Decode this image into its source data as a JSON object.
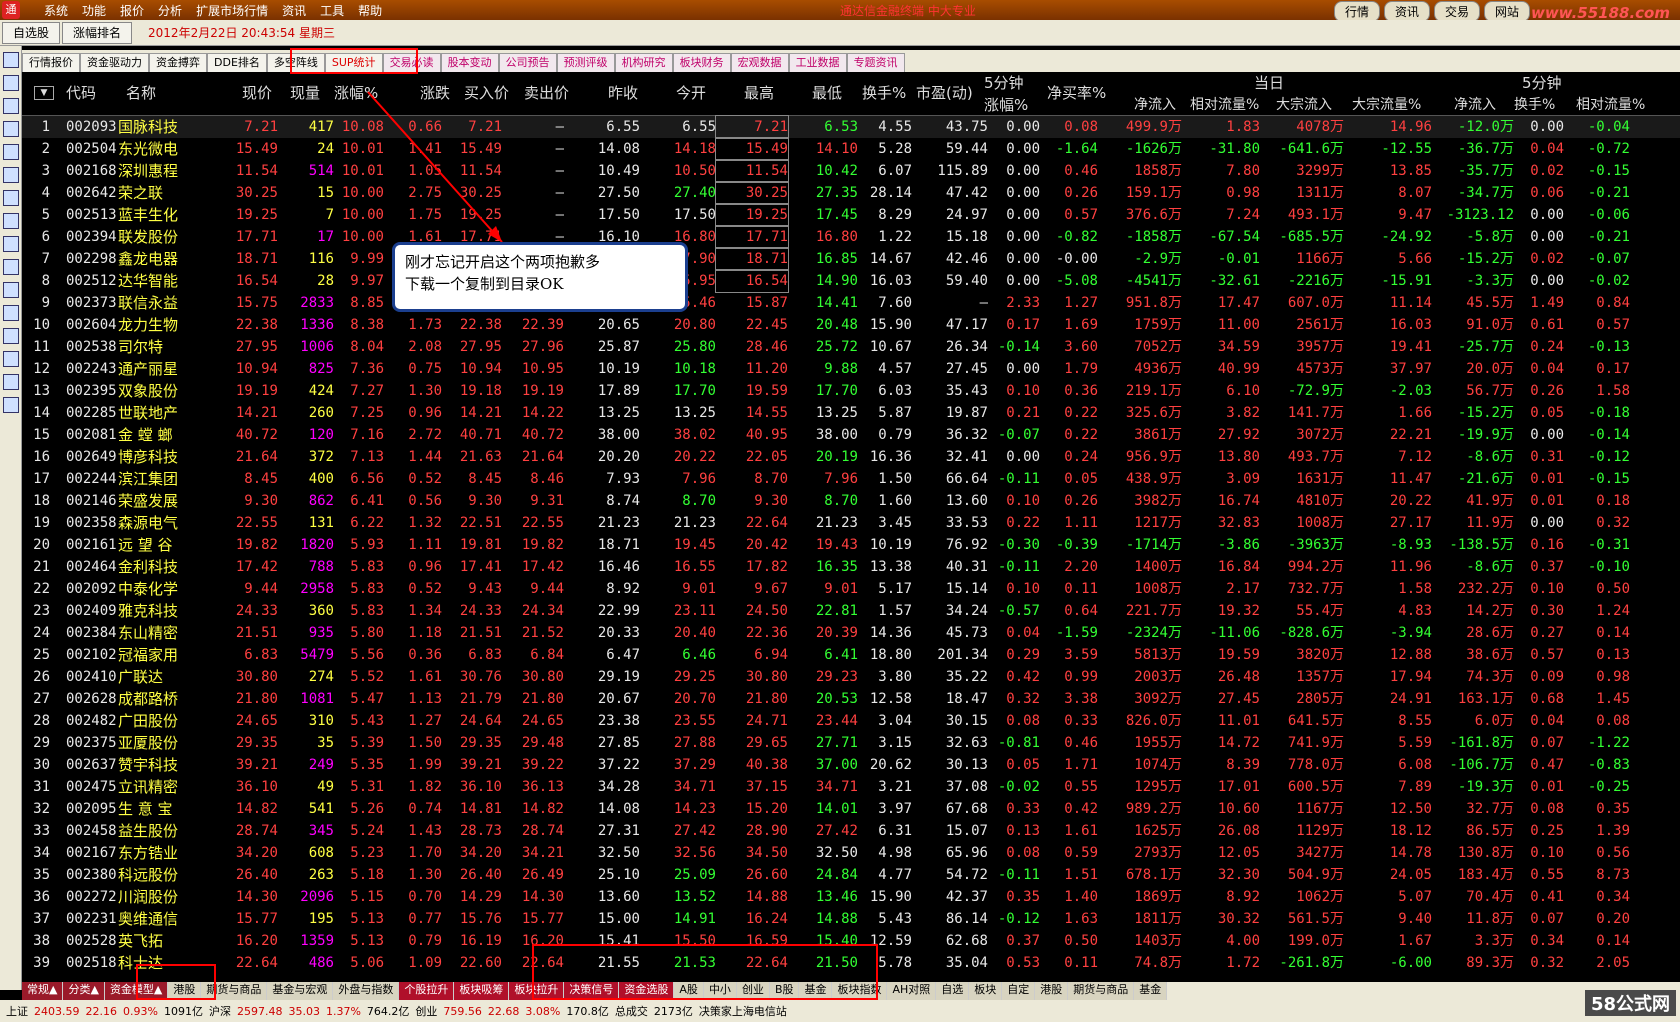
{
  "titlebar": {
    "menu": [
      "系统",
      "功能",
      "报价",
      "分析",
      "扩展市场行情",
      "资讯",
      "工具",
      "帮助"
    ],
    "title": "通达信金融终端 中大专业",
    "right_tabs": [
      "行情",
      "资讯",
      "交易",
      "网站"
    ],
    "site": "www.55188.com"
  },
  "toolbar": {
    "buttons": [
      "自选股",
      "涨幅排名"
    ],
    "datetime": "2012年2月22日 20:43:54 星期三"
  },
  "top_tabs": [
    "行情报价",
    "资金驱动力",
    "资金搏弈",
    "DDE排名",
    "多空阵线",
    "SUP统计",
    "交易必读",
    "股本变动",
    "公司预告",
    "预测评级",
    "机构研究",
    "板块财务",
    "宏观数据",
    "工业数据",
    "专题资讯"
  ],
  "header": {
    "cols": [
      "代码",
      "名称",
      "现价",
      "现量",
      "涨幅%",
      "涨跌",
      "买入价",
      "卖出价",
      "昨收",
      "今开",
      "最高",
      "最低",
      "换手%",
      "市盈(动)"
    ],
    "min5": "5分钟",
    "min5_rise": "涨幅%",
    "net_buy": "净买率%",
    "today": "当日",
    "today_cols": [
      "净流入",
      "相对流量%",
      "大宗流入",
      "大宗流量%"
    ],
    "min5b": "5分钟",
    "min5b_cols": [
      "净流入",
      "换手%",
      "相对流量%"
    ]
  },
  "rows": [
    [
      "1",
      "002093",
      "国脉科技",
      "7.21",
      "417",
      "10.08",
      "0.66",
      "7.21",
      "—",
      "6.55",
      "6.55",
      "7.21",
      "6.53",
      "4.55",
      "43.75",
      "0.00",
      "0.08",
      "499.9万",
      "1.83",
      "4078万",
      "14.96",
      "-12.0万",
      "0.00",
      "-0.04"
    ],
    [
      "2",
      "002504",
      "东光微电",
      "15.49",
      "24",
      "10.01",
      "1.41",
      "15.49",
      "—",
      "14.08",
      "14.18",
      "15.49",
      "14.10",
      "5.28",
      "59.44",
      "0.00",
      "-1.64",
      "-1626万",
      "-31.80",
      "-641.6万",
      "-12.55",
      "-36.7万",
      "0.04",
      "-0.72"
    ],
    [
      "3",
      "002168",
      "深圳惠程",
      "11.54",
      "514",
      "10.01",
      "1.05",
      "11.54",
      "—",
      "10.49",
      "10.50",
      "11.54",
      "10.42",
      "6.07",
      "115.89",
      "0.00",
      "0.46",
      "1858万",
      "7.80",
      "3299万",
      "13.85",
      "-35.7万",
      "0.02",
      "-0.15"
    ],
    [
      "4",
      "002642",
      "荣之联",
      "30.25",
      "15",
      "10.00",
      "2.75",
      "30.25",
      "—",
      "27.50",
      "27.40",
      "30.25",
      "27.35",
      "28.14",
      "47.42",
      "0.00",
      "0.26",
      "159.1万",
      "0.98",
      "1311万",
      "8.07",
      "-34.7万",
      "0.06",
      "-0.21"
    ],
    [
      "5",
      "002513",
      "蓝丰生化",
      "19.25",
      "7",
      "10.00",
      "1.75",
      "19.25",
      "—",
      "17.50",
      "17.50",
      "19.25",
      "17.45",
      "8.29",
      "24.97",
      "0.00",
      "0.57",
      "376.6万",
      "7.24",
      "493.1万",
      "9.47",
      "-3123.12",
      "0.00",
      "-0.06"
    ],
    [
      "6",
      "002394",
      "联发股份",
      "17.71",
      "17",
      "10.00",
      "1.61",
      "17.71",
      "—",
      "16.10",
      "16.80",
      "17.71",
      "16.80",
      "1.22",
      "15.18",
      "0.00",
      "-0.82",
      "-1858万",
      "-67.54",
      "-685.5万",
      "-24.92",
      "-5.8万",
      "0.00",
      "-0.21"
    ],
    [
      "7",
      "002298",
      "鑫龙电器",
      "18.71",
      "116",
      "9.99",
      "1.70",
      "18.71",
      "—",
      "17.01",
      "17.90",
      "18.71",
      "16.85",
      "14.67",
      "42.46",
      "0.00",
      "-0.00",
      "-2.9万",
      "-0.01",
      "1166万",
      "5.66",
      "-15.2万",
      "0.02",
      "-0.07"
    ],
    [
      "8",
      "002512",
      "达华智能",
      "16.54",
      "28",
      "9.97",
      "1.50",
      "16.54",
      "—",
      "15.04",
      "15.95",
      "16.54",
      "14.90",
      "16.03",
      "59.40",
      "0.00",
      "-5.08",
      "-4541万",
      "-32.61",
      "-2216万",
      "-15.91",
      "-3.3万",
      "0.00",
      "-0.02"
    ],
    [
      "9",
      "002373",
      "联信永益",
      "15.75",
      "2833",
      "8.85",
      "1.28",
      "15.74",
      "15.75",
      "14.47",
      "15.46",
      "15.87",
      "14.41",
      "7.60",
      "—",
      "2.33",
      "1.27",
      "951.8万",
      "17.47",
      "607.0万",
      "11.14",
      "45.5万",
      "1.49",
      "0.84"
    ],
    [
      "10",
      "002604",
      "龙力生物",
      "22.38",
      "1336",
      "8.38",
      "1.73",
      "22.38",
      "22.39",
      "20.65",
      "20.80",
      "22.45",
      "20.48",
      "15.90",
      "47.17",
      "0.17",
      "1.69",
      "1759万",
      "11.00",
      "2561万",
      "16.03",
      "91.0万",
      "0.61",
      "0.57"
    ],
    [
      "11",
      "002538",
      "司尔特",
      "27.95",
      "1006",
      "8.04",
      "2.08",
      "27.95",
      "27.96",
      "25.87",
      "25.80",
      "28.46",
      "25.72",
      "10.67",
      "26.34",
      "-0.14",
      "3.60",
      "7052万",
      "34.59",
      "3957万",
      "19.41",
      "-25.7万",
      "0.24",
      "-0.13"
    ],
    [
      "12",
      "002243",
      "通产丽星",
      "10.94",
      "825",
      "7.36",
      "0.75",
      "10.94",
      "10.95",
      "10.19",
      "10.18",
      "11.20",
      "9.88",
      "4.57",
      "27.45",
      "0.00",
      "1.79",
      "4936万",
      "40.99",
      "4573万",
      "37.97",
      "20.0万",
      "0.04",
      "0.17"
    ],
    [
      "13",
      "002395",
      "双象股份",
      "19.19",
      "424",
      "7.27",
      "1.30",
      "19.18",
      "19.19",
      "17.89",
      "17.70",
      "19.59",
      "17.70",
      "6.03",
      "35.43",
      "0.10",
      "0.36",
      "219.1万",
      "6.10",
      "-72.9万",
      "-2.03",
      "56.7万",
      "0.26",
      "1.58"
    ],
    [
      "14",
      "002285",
      "世联地产",
      "14.21",
      "260",
      "7.25",
      "0.96",
      "14.21",
      "14.22",
      "13.25",
      "13.25",
      "14.55",
      "13.25",
      "5.87",
      "19.87",
      "0.21",
      "0.22",
      "325.6万",
      "3.82",
      "141.7万",
      "1.66",
      "-15.2万",
      "0.05",
      "-0.18"
    ],
    [
      "15",
      "002081",
      "金 螳 螂",
      "40.72",
      "120",
      "7.16",
      "2.72",
      "40.71",
      "40.72",
      "38.00",
      "38.02",
      "40.95",
      "38.00",
      "0.79",
      "36.32",
      "-0.07",
      "0.22",
      "3861万",
      "27.92",
      "3072万",
      "22.21",
      "-19.9万",
      "0.00",
      "-0.14"
    ],
    [
      "16",
      "002649",
      "博彦科技",
      "21.64",
      "372",
      "7.13",
      "1.44",
      "21.63",
      "21.64",
      "20.20",
      "20.22",
      "22.05",
      "20.19",
      "16.36",
      "32.41",
      "0.00",
      "0.24",
      "956.9万",
      "13.80",
      "493.7万",
      "7.12",
      "-8.6万",
      "0.31",
      "-0.12"
    ],
    [
      "17",
      "002244",
      "滨江集团",
      "8.45",
      "400",
      "6.56",
      "0.52",
      "8.45",
      "8.46",
      "7.93",
      "7.96",
      "8.70",
      "7.96",
      "1.50",
      "66.64",
      "-0.11",
      "0.05",
      "438.9万",
      "3.09",
      "1631万",
      "11.47",
      "-21.6万",
      "0.01",
      "-0.15"
    ],
    [
      "18",
      "002146",
      "荣盛发展",
      "9.30",
      "862",
      "6.41",
      "0.56",
      "9.30",
      "9.31",
      "8.74",
      "8.70",
      "9.30",
      "8.70",
      "1.60",
      "13.60",
      "0.10",
      "0.26",
      "3982万",
      "16.74",
      "4810万",
      "20.22",
      "41.9万",
      "0.01",
      "0.18"
    ],
    [
      "19",
      "002358",
      "森源电气",
      "22.55",
      "131",
      "6.22",
      "1.32",
      "22.51",
      "22.55",
      "21.23",
      "21.23",
      "22.64",
      "21.23",
      "3.45",
      "33.53",
      "0.22",
      "1.11",
      "1217万",
      "32.83",
      "1008万",
      "27.17",
      "11.9万",
      "0.00",
      "0.32"
    ],
    [
      "20",
      "002161",
      "远 望 谷",
      "19.82",
      "1820",
      "5.93",
      "1.11",
      "19.81",
      "19.82",
      "18.71",
      "19.45",
      "20.42",
      "19.43",
      "10.19",
      "76.92",
      "-0.30",
      "-0.39",
      "-1714万",
      "-3.86",
      "-3963万",
      "-8.93",
      "-138.5万",
      "0.16",
      "-0.31"
    ],
    [
      "21",
      "002464",
      "金利科技",
      "17.42",
      "788",
      "5.83",
      "0.96",
      "17.41",
      "17.42",
      "16.46",
      "16.55",
      "17.82",
      "16.35",
      "13.38",
      "40.31",
      "-0.11",
      "2.20",
      "1400万",
      "16.84",
      "994.2万",
      "11.96",
      "-8.6万",
      "0.37",
      "-0.10"
    ],
    [
      "22",
      "002092",
      "中泰化学",
      "9.44",
      "2958",
      "5.83",
      "0.52",
      "9.43",
      "9.44",
      "8.92",
      "9.01",
      "9.67",
      "9.01",
      "5.17",
      "15.14",
      "0.10",
      "0.11",
      "1008万",
      "2.17",
      "732.7万",
      "1.58",
      "232.2万",
      "0.10",
      "0.50"
    ],
    [
      "23",
      "002409",
      "雅克科技",
      "24.33",
      "360",
      "5.83",
      "1.34",
      "24.33",
      "24.34",
      "22.99",
      "23.11",
      "24.50",
      "22.81",
      "1.57",
      "34.24",
      "-0.57",
      "0.64",
      "221.7万",
      "19.32",
      "55.4万",
      "4.83",
      "14.2万",
      "0.30",
      "1.24"
    ],
    [
      "24",
      "002384",
      "东山精密",
      "21.51",
      "935",
      "5.80",
      "1.18",
      "21.51",
      "21.52",
      "20.33",
      "20.40",
      "22.36",
      "20.39",
      "14.36",
      "45.73",
      "0.04",
      "-1.59",
      "-2324万",
      "-11.06",
      "-828.6万",
      "-3.94",
      "28.6万",
      "0.27",
      "0.14"
    ],
    [
      "25",
      "002102",
      "冠福家用",
      "6.83",
      "5479",
      "5.56",
      "0.36",
      "6.83",
      "6.84",
      "6.47",
      "6.46",
      "6.94",
      "6.41",
      "18.80",
      "201.34",
      "0.29",
      "3.59",
      "5813万",
      "19.59",
      "3820万",
      "12.88",
      "38.6万",
      "0.57",
      "0.13"
    ],
    [
      "26",
      "002410",
      "广联达",
      "30.80",
      "274",
      "5.52",
      "1.61",
      "30.76",
      "30.80",
      "29.19",
      "29.25",
      "30.80",
      "29.23",
      "3.80",
      "35.22",
      "0.42",
      "0.99",
      "2003万",
      "26.48",
      "1357万",
      "17.94",
      "74.3万",
      "0.09",
      "0.98"
    ],
    [
      "27",
      "002628",
      "成都路桥",
      "21.80",
      "1081",
      "5.47",
      "1.13",
      "21.79",
      "21.80",
      "20.67",
      "20.70",
      "21.80",
      "20.53",
      "12.58",
      "18.47",
      "0.32",
      "3.38",
      "3092万",
      "27.45",
      "2805万",
      "24.91",
      "163.1万",
      "0.68",
      "1.45"
    ],
    [
      "28",
      "002482",
      "广田股份",
      "24.65",
      "310",
      "5.43",
      "1.27",
      "24.64",
      "24.65",
      "23.38",
      "23.55",
      "24.71",
      "23.44",
      "3.04",
      "30.15",
      "0.08",
      "0.33",
      "826.0万",
      "11.01",
      "641.5万",
      "8.55",
      "6.0万",
      "0.04",
      "0.08"
    ],
    [
      "29",
      "002375",
      "亚厦股份",
      "29.35",
      "35",
      "5.39",
      "1.50",
      "29.35",
      "29.48",
      "27.85",
      "27.88",
      "29.65",
      "27.71",
      "3.15",
      "32.63",
      "-0.81",
      "0.46",
      "1955万",
      "14.72",
      "741.9万",
      "5.59",
      "-161.8万",
      "0.07",
      "-1.22"
    ],
    [
      "30",
      "002637",
      "赞宇科技",
      "39.21",
      "249",
      "5.35",
      "1.99",
      "39.21",
      "39.22",
      "37.22",
      "37.29",
      "40.38",
      "37.00",
      "20.62",
      "30.13",
      "0.05",
      "1.71",
      "1074万",
      "8.39",
      "778.0万",
      "6.08",
      "-106.7万",
      "0.47",
      "-0.83"
    ],
    [
      "31",
      "002475",
      "立讯精密",
      "36.10",
      "49",
      "5.31",
      "1.82",
      "36.10",
      "36.13",
      "34.28",
      "34.71",
      "37.15",
      "34.71",
      "3.21",
      "37.08",
      "-0.02",
      "0.55",
      "1295万",
      "17.01",
      "600.5万",
      "7.89",
      "-19.3万",
      "0.01",
      "-0.25"
    ],
    [
      "32",
      "002095",
      "生 意 宝",
      "14.82",
      "541",
      "5.26",
      "0.74",
      "14.81",
      "14.82",
      "14.08",
      "14.23",
      "15.20",
      "14.01",
      "3.97",
      "67.68",
      "0.33",
      "0.42",
      "989.2万",
      "10.60",
      "1167万",
      "12.50",
      "32.7万",
      "0.08",
      "0.35"
    ],
    [
      "33",
      "002458",
      "益生股份",
      "28.74",
      "345",
      "5.24",
      "1.43",
      "28.73",
      "28.74",
      "27.31",
      "27.42",
      "28.90",
      "27.42",
      "6.31",
      "15.07",
      "0.13",
      "1.61",
      "1625万",
      "26.08",
      "1129万",
      "18.12",
      "86.5万",
      "0.25",
      "1.39"
    ],
    [
      "34",
      "002167",
      "东方锆业",
      "34.20",
      "608",
      "5.23",
      "1.70",
      "34.20",
      "34.21",
      "32.50",
      "32.56",
      "34.50",
      "32.50",
      "4.98",
      "65.96",
      "0.08",
      "0.59",
      "2793万",
      "12.05",
      "3427万",
      "14.78",
      "130.8万",
      "0.10",
      "0.56"
    ],
    [
      "35",
      "002380",
      "科远股份",
      "26.40",
      "263",
      "5.18",
      "1.30",
      "26.40",
      "26.49",
      "25.10",
      "25.09",
      "26.60",
      "24.84",
      "4.77",
      "54.72",
      "-0.11",
      "1.51",
      "678.1万",
      "32.30",
      "504.9万",
      "24.05",
      "183.4万",
      "0.55",
      "8.73"
    ],
    [
      "36",
      "002272",
      "川润股份",
      "14.30",
      "2096",
      "5.15",
      "0.70",
      "14.29",
      "14.30",
      "13.60",
      "13.52",
      "14.88",
      "13.46",
      "15.90",
      "42.37",
      "0.35",
      "1.40",
      "1869万",
      "8.92",
      "1062万",
      "5.07",
      "70.4万",
      "0.41",
      "0.34"
    ],
    [
      "37",
      "002231",
      "奥维通信",
      "15.77",
      "195",
      "5.13",
      "0.77",
      "15.76",
      "15.77",
      "15.00",
      "14.91",
      "16.24",
      "14.88",
      "5.43",
      "86.14",
      "-0.12",
      "1.63",
      "1811万",
      "30.32",
      "561.5万",
      "9.40",
      "11.8万",
      "0.07",
      "0.20"
    ],
    [
      "38",
      "002528",
      "英飞拓",
      "16.20",
      "1359",
      "5.13",
      "0.79",
      "16.19",
      "16.20",
      "15.41",
      "15.50",
      "16.59",
      "15.40",
      "12.59",
      "62.68",
      "0.37",
      "0.50",
      "1403万",
      "4.00",
      "199.0万",
      "1.67",
      "3.3万",
      "0.34",
      "0.14"
    ],
    [
      "39",
      "002518",
      "科士达",
      "22.64",
      "486",
      "5.06",
      "1.09",
      "22.60",
      "22.64",
      "21.55",
      "21.53",
      "22.64",
      "21.50",
      "5.78",
      "35.04",
      "0.53",
      "0.11",
      "74.8万",
      "1.72",
      "-261.8万",
      "-6.00",
      "89.3万",
      "0.32",
      "2.05"
    ]
  ],
  "callout": {
    "line1": "刚才忘记开启这个两项抱歉多",
    "line2": "下载一个复制到目录OK"
  },
  "bottom_tabs": [
    "常规▲",
    "分类▲",
    "资金模型▲",
    "港股",
    "期货与商品",
    "基金与宏观",
    "外盘与指数",
    "个股拉升",
    "板块吸筹",
    "板块拉升",
    "决策信号",
    "资金选股",
    "A股",
    "中小",
    "创业",
    "B股",
    "基金",
    "板块指数",
    "AH对照",
    "自选",
    "板块",
    "自定",
    "港股",
    "期货与商品",
    "基金"
  ],
  "status": [
    "上证",
    "2403.59",
    "22.16",
    "0.93%",
    "1091亿",
    "沪深",
    "2597.48",
    "35.03",
    "1.37%",
    "764.2亿",
    "创业",
    "759.56",
    "22.68",
    "3.08%",
    "170.8亿",
    "总成交",
    "2173亿",
    "决策家上海电信站"
  ],
  "watermark": "58公式网"
}
